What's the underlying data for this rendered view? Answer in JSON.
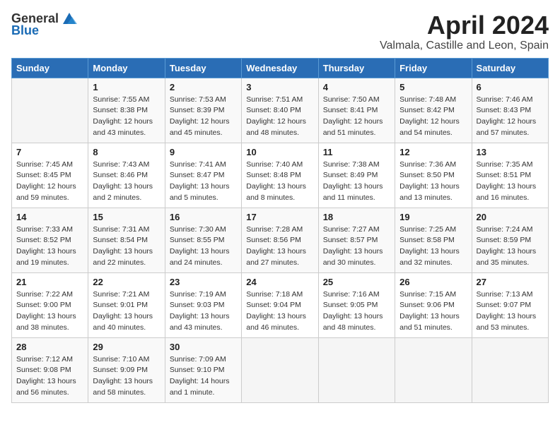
{
  "header": {
    "logo_general": "General",
    "logo_blue": "Blue",
    "title": "April 2024",
    "subtitle": "Valmala, Castille and Leon, Spain"
  },
  "weekdays": [
    "Sunday",
    "Monday",
    "Tuesday",
    "Wednesday",
    "Thursday",
    "Friday",
    "Saturday"
  ],
  "weeks": [
    [
      {
        "day": "",
        "info": ""
      },
      {
        "day": "1",
        "info": "Sunrise: 7:55 AM\nSunset: 8:38 PM\nDaylight: 12 hours\nand 43 minutes."
      },
      {
        "day": "2",
        "info": "Sunrise: 7:53 AM\nSunset: 8:39 PM\nDaylight: 12 hours\nand 45 minutes."
      },
      {
        "day": "3",
        "info": "Sunrise: 7:51 AM\nSunset: 8:40 PM\nDaylight: 12 hours\nand 48 minutes."
      },
      {
        "day": "4",
        "info": "Sunrise: 7:50 AM\nSunset: 8:41 PM\nDaylight: 12 hours\nand 51 minutes."
      },
      {
        "day": "5",
        "info": "Sunrise: 7:48 AM\nSunset: 8:42 PM\nDaylight: 12 hours\nand 54 minutes."
      },
      {
        "day": "6",
        "info": "Sunrise: 7:46 AM\nSunset: 8:43 PM\nDaylight: 12 hours\nand 57 minutes."
      }
    ],
    [
      {
        "day": "7",
        "info": "Sunrise: 7:45 AM\nSunset: 8:45 PM\nDaylight: 12 hours\nand 59 minutes."
      },
      {
        "day": "8",
        "info": "Sunrise: 7:43 AM\nSunset: 8:46 PM\nDaylight: 13 hours\nand 2 minutes."
      },
      {
        "day": "9",
        "info": "Sunrise: 7:41 AM\nSunset: 8:47 PM\nDaylight: 13 hours\nand 5 minutes."
      },
      {
        "day": "10",
        "info": "Sunrise: 7:40 AM\nSunset: 8:48 PM\nDaylight: 13 hours\nand 8 minutes."
      },
      {
        "day": "11",
        "info": "Sunrise: 7:38 AM\nSunset: 8:49 PM\nDaylight: 13 hours\nand 11 minutes."
      },
      {
        "day": "12",
        "info": "Sunrise: 7:36 AM\nSunset: 8:50 PM\nDaylight: 13 hours\nand 13 minutes."
      },
      {
        "day": "13",
        "info": "Sunrise: 7:35 AM\nSunset: 8:51 PM\nDaylight: 13 hours\nand 16 minutes."
      }
    ],
    [
      {
        "day": "14",
        "info": "Sunrise: 7:33 AM\nSunset: 8:52 PM\nDaylight: 13 hours\nand 19 minutes."
      },
      {
        "day": "15",
        "info": "Sunrise: 7:31 AM\nSunset: 8:54 PM\nDaylight: 13 hours\nand 22 minutes."
      },
      {
        "day": "16",
        "info": "Sunrise: 7:30 AM\nSunset: 8:55 PM\nDaylight: 13 hours\nand 24 minutes."
      },
      {
        "day": "17",
        "info": "Sunrise: 7:28 AM\nSunset: 8:56 PM\nDaylight: 13 hours\nand 27 minutes."
      },
      {
        "day": "18",
        "info": "Sunrise: 7:27 AM\nSunset: 8:57 PM\nDaylight: 13 hours\nand 30 minutes."
      },
      {
        "day": "19",
        "info": "Sunrise: 7:25 AM\nSunset: 8:58 PM\nDaylight: 13 hours\nand 32 minutes."
      },
      {
        "day": "20",
        "info": "Sunrise: 7:24 AM\nSunset: 8:59 PM\nDaylight: 13 hours\nand 35 minutes."
      }
    ],
    [
      {
        "day": "21",
        "info": "Sunrise: 7:22 AM\nSunset: 9:00 PM\nDaylight: 13 hours\nand 38 minutes."
      },
      {
        "day": "22",
        "info": "Sunrise: 7:21 AM\nSunset: 9:01 PM\nDaylight: 13 hours\nand 40 minutes."
      },
      {
        "day": "23",
        "info": "Sunrise: 7:19 AM\nSunset: 9:03 PM\nDaylight: 13 hours\nand 43 minutes."
      },
      {
        "day": "24",
        "info": "Sunrise: 7:18 AM\nSunset: 9:04 PM\nDaylight: 13 hours\nand 46 minutes."
      },
      {
        "day": "25",
        "info": "Sunrise: 7:16 AM\nSunset: 9:05 PM\nDaylight: 13 hours\nand 48 minutes."
      },
      {
        "day": "26",
        "info": "Sunrise: 7:15 AM\nSunset: 9:06 PM\nDaylight: 13 hours\nand 51 minutes."
      },
      {
        "day": "27",
        "info": "Sunrise: 7:13 AM\nSunset: 9:07 PM\nDaylight: 13 hours\nand 53 minutes."
      }
    ],
    [
      {
        "day": "28",
        "info": "Sunrise: 7:12 AM\nSunset: 9:08 PM\nDaylight: 13 hours\nand 56 minutes."
      },
      {
        "day": "29",
        "info": "Sunrise: 7:10 AM\nSunset: 9:09 PM\nDaylight: 13 hours\nand 58 minutes."
      },
      {
        "day": "30",
        "info": "Sunrise: 7:09 AM\nSunset: 9:10 PM\nDaylight: 14 hours\nand 1 minute."
      },
      {
        "day": "",
        "info": ""
      },
      {
        "day": "",
        "info": ""
      },
      {
        "day": "",
        "info": ""
      },
      {
        "day": "",
        "info": ""
      }
    ]
  ]
}
